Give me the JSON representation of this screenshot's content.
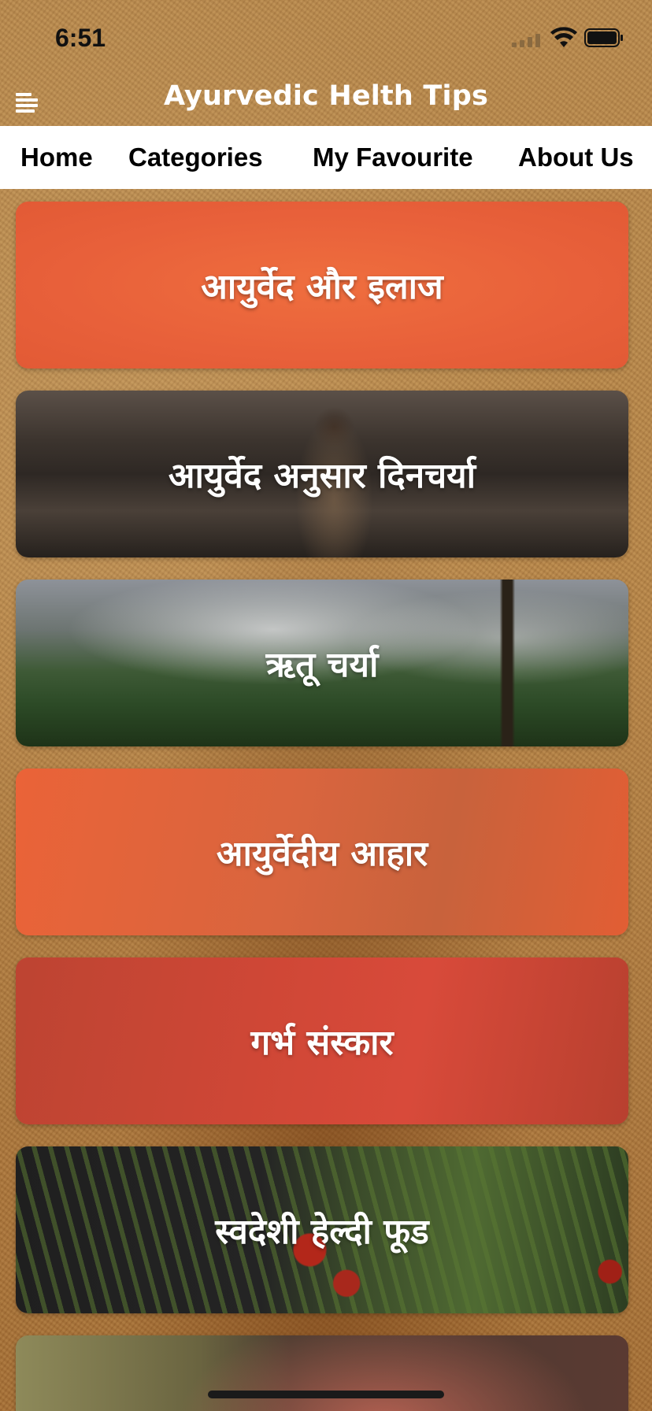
{
  "status_bar": {
    "time": "6:51",
    "icons": [
      "signal-icon",
      "wifi-icon",
      "battery-icon"
    ]
  },
  "header": {
    "menu_icon": "hamburger-menu-icon",
    "title": "Ayurvedic Helth Tips"
  },
  "tabs": [
    {
      "label": "Home"
    },
    {
      "label": "Categories"
    },
    {
      "label": "My Favourite"
    },
    {
      "label": "About Us"
    }
  ],
  "categories": [
    {
      "label": "आयुर्वेद और इलाज",
      "background": "orange-gradient"
    },
    {
      "label": "आयुर्वेद अनुसार दिनचर्या",
      "background": "meditation-at-sea-photo"
    },
    {
      "label": "ऋतू चर्या",
      "background": "misty-hills-photo"
    },
    {
      "label": "आयुर्वेदीय आहार",
      "background": "orange-gradient"
    },
    {
      "label": "गर्भ संस्कार",
      "background": "red-gradient"
    },
    {
      "label": "स्वदेशी हेल्दी फूड",
      "background": "vegetables-photo"
    }
  ],
  "colors": {
    "background": "#b8874a",
    "tab_bar": "#ffffff",
    "card_orange": "#e8633a",
    "card_red": "#c94436",
    "text_light": "#ffffff"
  }
}
